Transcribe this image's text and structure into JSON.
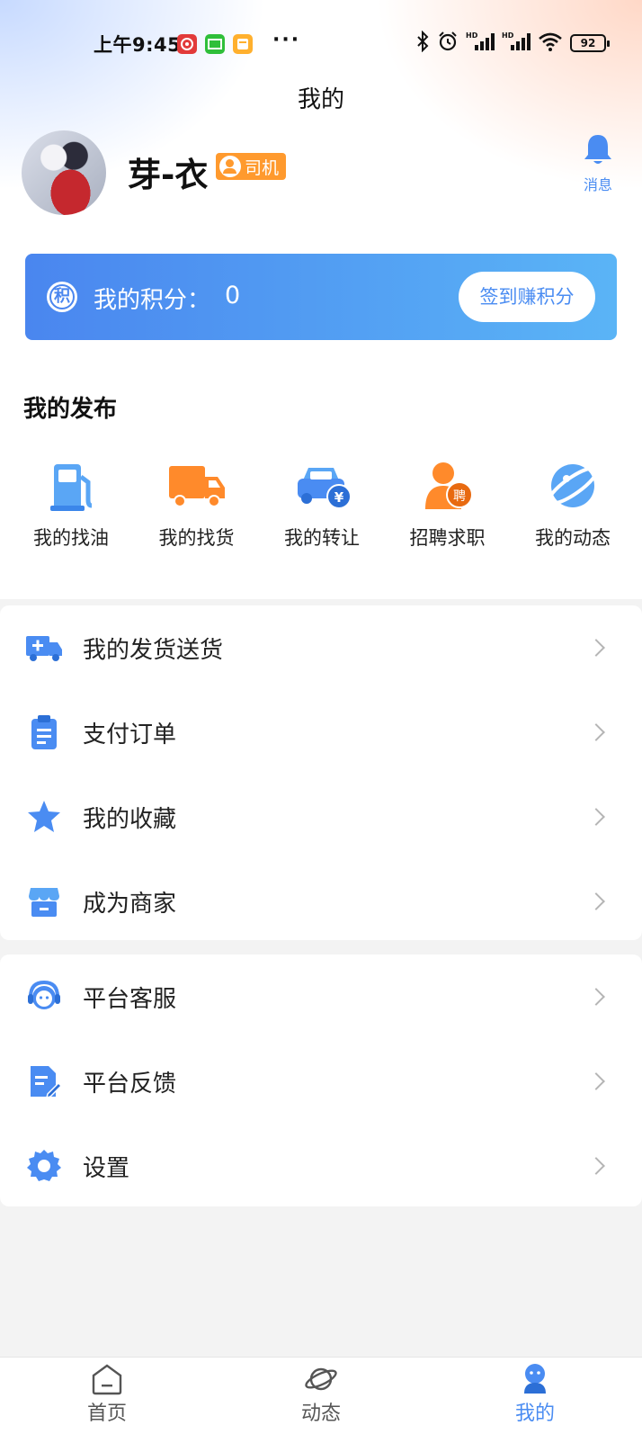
{
  "status_bar": {
    "time": "上午9:45",
    "battery": "92",
    "app_icons": [
      {
        "name": "netease-music-icon",
        "color": "#e23a3a"
      },
      {
        "name": "iqiyi-icon",
        "color": "#2fbf3a"
      },
      {
        "name": "notes-app-icon",
        "color": "#ffb02e"
      }
    ],
    "more": "···"
  },
  "header": {
    "title": "我的"
  },
  "profile": {
    "name": "芽-衣",
    "role_badge": "司机",
    "message_label": "消息"
  },
  "points": {
    "label": "我的积分：",
    "value": "0",
    "badge_char": "积",
    "checkin_label": "签到赚积分"
  },
  "my_publish": {
    "title": "我的发布",
    "items": [
      {
        "label": "我的找油",
        "icon": "fuel-pump-icon"
      },
      {
        "label": "我的找货",
        "icon": "truck-icon"
      },
      {
        "label": "我的转让",
        "icon": "car-transfer-icon"
      },
      {
        "label": "招聘求职",
        "icon": "recruit-icon",
        "badge": "聘"
      },
      {
        "label": "我的动态",
        "icon": "planet-icon"
      }
    ]
  },
  "menu_group_1": [
    {
      "label": "我的发货送货",
      "icon": "delivery-truck-icon"
    },
    {
      "label": "支付订单",
      "icon": "clipboard-icon"
    },
    {
      "label": "我的收藏",
      "icon": "star-icon"
    },
    {
      "label": "成为商家",
      "icon": "store-icon"
    }
  ],
  "menu_group_2": [
    {
      "label": "平台客服",
      "icon": "customer-service-icon"
    },
    {
      "label": "平台反馈",
      "icon": "feedback-icon"
    },
    {
      "label": "设置",
      "icon": "gear-icon"
    }
  ],
  "bottom_nav": [
    {
      "label": "首页",
      "icon": "home-icon",
      "active": false
    },
    {
      "label": "动态",
      "icon": "planet-icon",
      "active": false
    },
    {
      "label": "我的",
      "icon": "profile-icon",
      "active": true
    }
  ],
  "colors": {
    "accent": "#4a8cf2",
    "badge_orange": "#ff9a2e"
  }
}
